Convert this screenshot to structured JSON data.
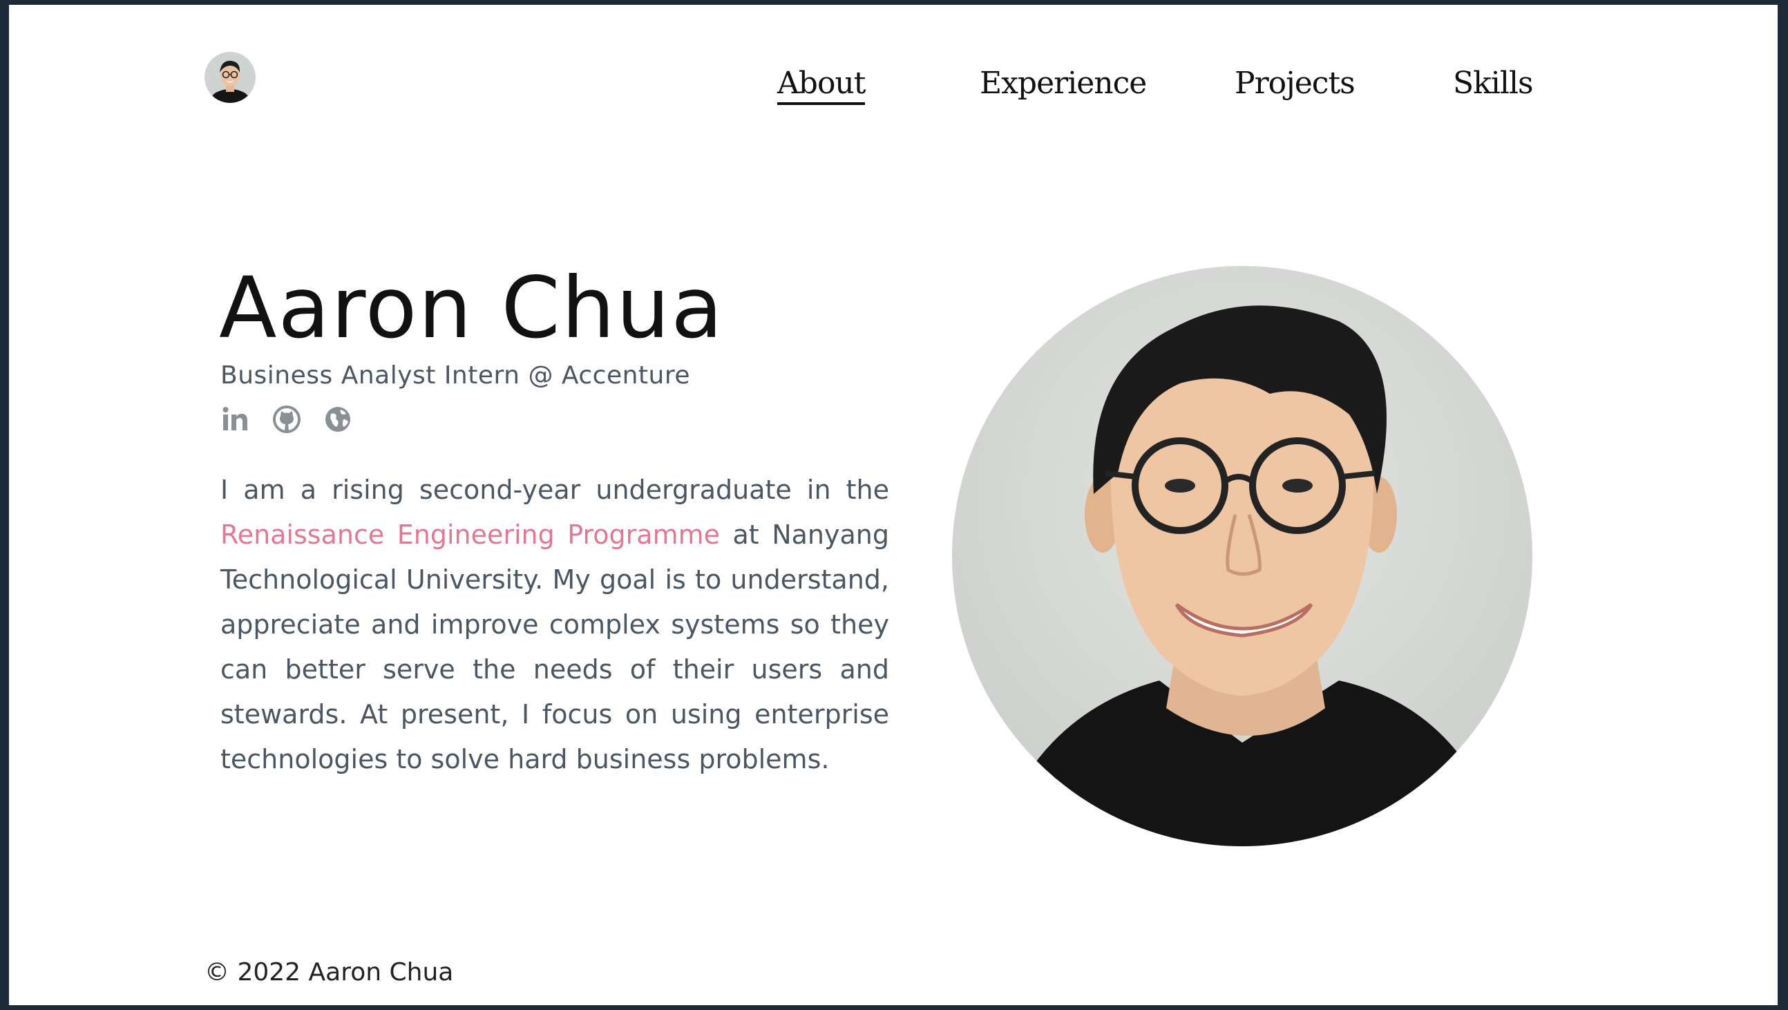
{
  "nav": {
    "items": [
      {
        "label": "About",
        "active": true
      },
      {
        "label": "Experience",
        "active": false
      },
      {
        "label": "Projects",
        "active": false
      },
      {
        "label": "Skills",
        "active": false
      }
    ]
  },
  "hero": {
    "name": "Aaron Chua",
    "subtitle": "Business Analyst Intern @ Accenture",
    "socials": [
      {
        "icon": "linkedin-icon"
      },
      {
        "icon": "github-icon"
      },
      {
        "icon": "globe-icon"
      }
    ],
    "bio_before": "I am a rising second-year undergraduate in the ",
    "bio_link": "Renaissance Engineering Programme",
    "bio_after": " at Nanyang Technological University. My goal is to understand, appreciate and improve complex systems so they can better serve the needs of their users and stewards. At present, I focus on using enterprise technologies to solve hard business problems."
  },
  "footer": {
    "copyright": "© 2022 Aaron Chua"
  },
  "colors": {
    "text": "#111111",
    "muted": "#4a5763",
    "link": "#e07a94",
    "icon": "#8a8f94",
    "background": "#ffffff"
  }
}
